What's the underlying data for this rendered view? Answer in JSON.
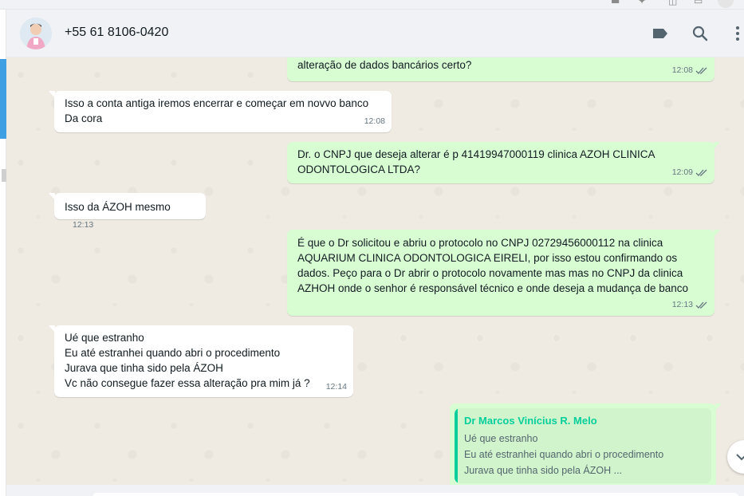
{
  "header": {
    "contact_name": "+55 61 8106-0420",
    "icons": [
      "label-icon",
      "search-icon",
      "menu-icon"
    ]
  },
  "messages": [
    {
      "direction": "outgoing",
      "text": "alteração de dados bancários certo?",
      "time": "12:08",
      "status": "read"
    },
    {
      "direction": "incoming",
      "text": "Isso a conta antiga iremos encerrar e começar  em novvo banco\nDa  cora",
      "time": "12:08"
    },
    {
      "direction": "outgoing",
      "text": "Dr. o CNPJ que deseja alterar é p 41419947000119 clinica AZOH CLINICA\nODONTOLOGICA LTDA?",
      "time": "12:09",
      "status": "read"
    },
    {
      "direction": "incoming",
      "text": "Isso da ÁZOH mesmo",
      "time": "12:13"
    },
    {
      "direction": "outgoing",
      "text": "É que o Dr solicitou e abriu o protocolo no CNPJ 02729456000112  na clinica\nAQUARIUM CLINICA ODONTOLOGICA EIRELI, por isso estou confirmando os\ndados. Peço para o Dr abrir o protocolo novamente mas mas no CNPJ da clinica\nAZHOH onde o senhor é responsável técnico e onde deseja a mudança de banco",
      "time": "12:13",
      "status": "read"
    },
    {
      "direction": "incoming",
      "text": "Ué que  estranho\nEu até estranhei quando abri o procedimento\nJurava que tinha sido pela ÁZOH\nVc não consegue fazer  essa  alteração pra mim já ?",
      "time": "12:14"
    }
  ],
  "quoted_reply": {
    "author": "Dr Marcos Vinícius R. Melo",
    "text": "Ué que  estranho\nEu até estranhei quando abri o procedimento\nJurava que tinha sido pela ÁZOH ..."
  },
  "colors": {
    "incoming_bubble": "#ffffff",
    "outgoing_bubble": "#d9fdd3",
    "chat_background": "#efeae2",
    "quote_accent": "#06cf9c",
    "ticks_read": "#667781"
  }
}
